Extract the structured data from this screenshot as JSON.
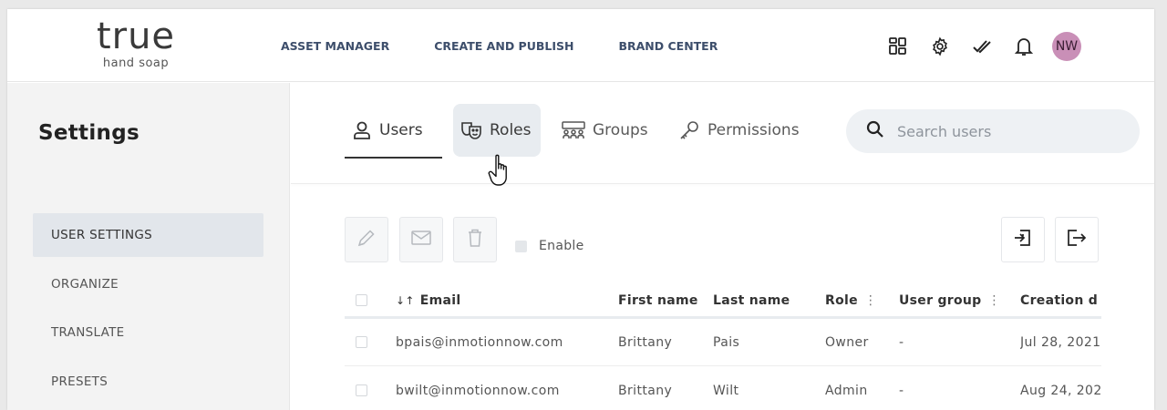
{
  "logo": {
    "main": "true",
    "sub": "hand soap"
  },
  "top_nav": [
    "ASSET MANAGER",
    "CREATE AND PUBLISH",
    "BRAND CENTER"
  ],
  "header_icons": [
    "grid-icon",
    "gear-icon",
    "checkmarks-icon",
    "bell-icon"
  ],
  "user": {
    "initials": "NW",
    "avatar_color": "#c98fb7"
  },
  "sidebar": {
    "title": "Settings",
    "items": [
      {
        "label": "USER SETTINGS",
        "active": true
      },
      {
        "label": "ORGANIZE"
      },
      {
        "label": "TRANSLATE"
      },
      {
        "label": "PRESETS"
      }
    ]
  },
  "tabs": [
    {
      "label": "Users",
      "icon": "user-icon",
      "selected": true
    },
    {
      "label": "Roles",
      "icon": "masks-icon",
      "hovered": true
    },
    {
      "label": "Groups",
      "icon": "group-icon"
    },
    {
      "label": "Permissions",
      "icon": "key-icon"
    }
  ],
  "search": {
    "placeholder": "Search users"
  },
  "toolbar": {
    "enable_label": "Enable",
    "left_icons": [
      "pencil-icon",
      "envelope-icon",
      "trash-icon"
    ],
    "right_icons": [
      "import-icon",
      "export-icon"
    ]
  },
  "table": {
    "headers": {
      "sort_glyph": "↓↑",
      "email": "Email",
      "first_name": "First name",
      "last_name": "Last name",
      "role": "Role",
      "user_group": "User group",
      "creation_date": "Creation d",
      "menu_glyph": "⋮"
    },
    "rows": [
      {
        "email": "bpais@inmotionnow.com",
        "first_name": "Brittany",
        "last_name": "Pais",
        "role": "Owner",
        "user_group": "-",
        "creation_date": "Jul 28, 2021"
      },
      {
        "email": "bwilt@inmotionnow.com",
        "first_name": "Brittany",
        "last_name": "Wilt",
        "role": "Admin",
        "user_group": "-",
        "creation_date": "Aug 24, 202"
      }
    ]
  },
  "colors": {
    "nav_text": "#3d4e6b",
    "active_side": "#e2e6eb",
    "search_bg": "#eef1f4"
  }
}
